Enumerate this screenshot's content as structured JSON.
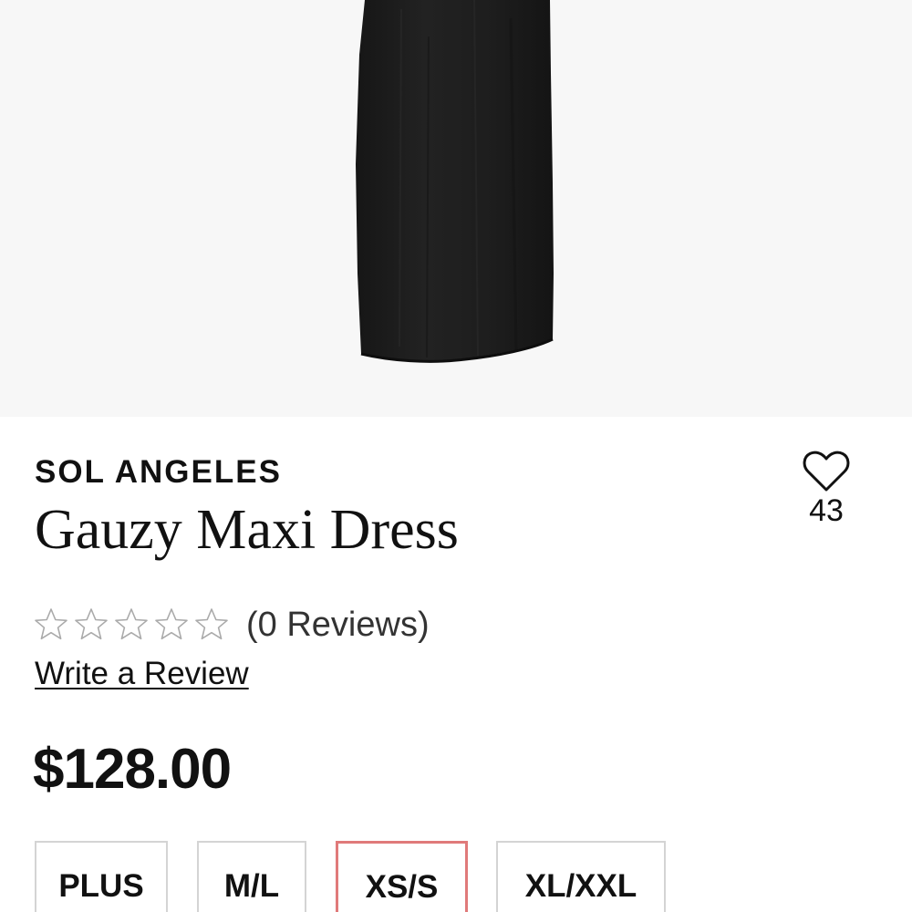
{
  "product": {
    "brand": "SOL ANGELES",
    "name": "Gauzy Maxi Dress",
    "price": "$128.00",
    "image_alt": "black gauzy maxi dress",
    "image_background": "#f7f7f7",
    "dress_color": "#1c1c1c"
  },
  "favorite": {
    "count": "43",
    "icon": "heart-outline-icon"
  },
  "reviews": {
    "rating": 0,
    "max_rating": 5,
    "star_icon": "star-outline-icon",
    "count_text": "(0 Reviews)",
    "write_review_label": "Write a Review"
  },
  "sizes": {
    "options": [
      "PLUS",
      "M/L",
      "XS/S",
      "XL/XXL"
    ],
    "selected": "XS/S",
    "selected_border_color": "#e07a7a"
  }
}
